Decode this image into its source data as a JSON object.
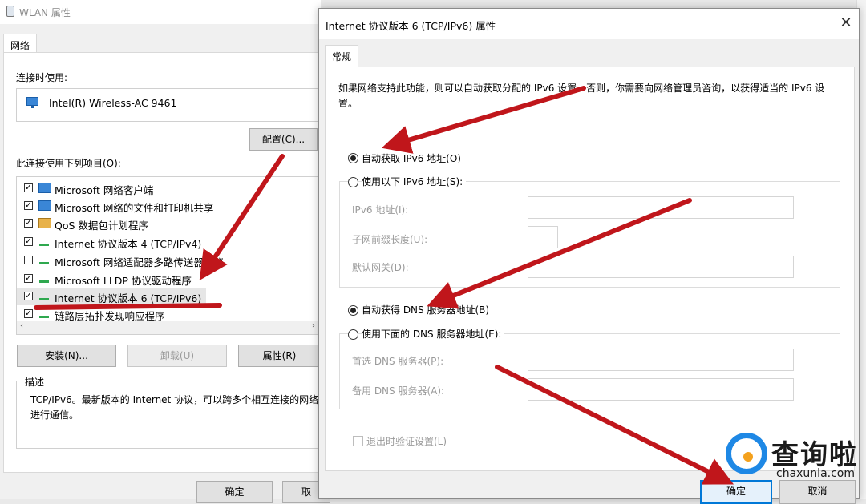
{
  "wlan_window": {
    "title": "WLAN 属性",
    "tab": "网络",
    "connect_using_label": "连接时使用:",
    "adapter_name": "Intel(R) Wireless-AC 9461",
    "configure_button": "配置(C)...",
    "items_label": "此连接使用下列项目(O):",
    "items": [
      {
        "label": "Microsoft 网络客户端",
        "checked": true,
        "icon": "network-icon"
      },
      {
        "label": "Microsoft 网络的文件和打印机共享",
        "checked": true,
        "icon": "network-icon"
      },
      {
        "label": "QoS 数据包计划程序",
        "checked": true,
        "icon": "qos-icon"
      },
      {
        "label": "Internet 协议版本 4 (TCP/IPv4)",
        "checked": true,
        "icon": "protocol-icon"
      },
      {
        "label": "Microsoft 网络适配器多路传送器协议",
        "checked": false,
        "icon": "protocol-icon"
      },
      {
        "label": "Microsoft LLDP 协议驱动程序",
        "checked": true,
        "icon": "protocol-icon"
      },
      {
        "label": "Internet 协议版本 6 (TCP/IPv6)",
        "checked": true,
        "icon": "protocol-icon",
        "selected": true
      },
      {
        "label": "链路层拓扑发现响应程序",
        "checked": true,
        "icon": "protocol-icon"
      }
    ],
    "scroll_left": "‹",
    "scroll_right": "›",
    "install_button": "安装(N)...",
    "uninstall_button": "卸载(U)",
    "properties_button": "属性(R)",
    "description_legend": "描述",
    "description_text": "TCP/IPv6。最新版本的 Internet 协议，可以跨多个相互连接的网络进行通信。",
    "ok_button": "确定",
    "cancel_button": "取"
  },
  "ipv6_dialog": {
    "title": "Internet 协议版本 6 (TCP/IPv6) 属性",
    "close": "✕",
    "tab": "常规",
    "intro": "如果网络支持此功能，则可以自动获取分配的 IPv6 设置。否则，你需要向网络管理员咨询，以获得适当的 IPv6 设置。",
    "auto_ip_radio": "自动获取 IPv6 地址(O)",
    "manual_ip_radio": "使用以下 IPv6 地址(S):",
    "ipv6_address_label": "IPv6 地址(I):",
    "prefix_length_label": "子网前缀长度(U):",
    "gateway_label": "默认网关(D):",
    "auto_dns_radio": "自动获得 DNS 服务器地址(B)",
    "manual_dns_radio": "使用下面的 DNS 服务器地址(E):",
    "preferred_dns_label": "首选 DNS 服务器(P):",
    "alternate_dns_label": "备用 DNS 服务器(A):",
    "validate_on_exit": "退出时验证设置(L)",
    "ok_button": "确定",
    "cancel_button": "取消",
    "ip_mode": "auto",
    "dns_mode": "auto"
  },
  "watermark": {
    "title": "查询啦",
    "url": "chaxunla.com"
  },
  "colors": {
    "annotation_arrow": "#c0161b",
    "accent": "#0078d7",
    "watermark_blue": "#1e88e5",
    "watermark_orange": "#f4a11d"
  }
}
